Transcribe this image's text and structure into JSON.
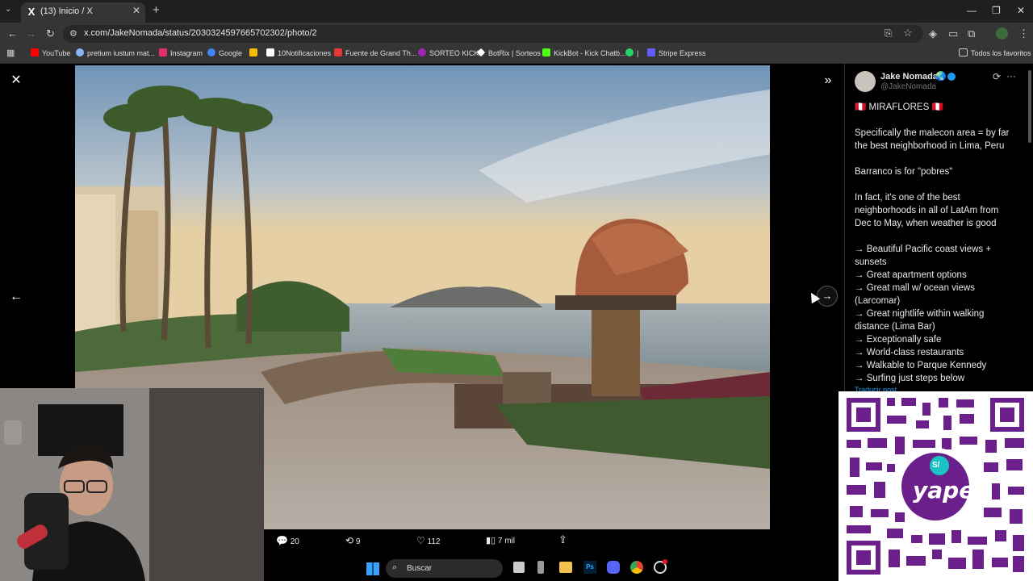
{
  "browser": {
    "tab": {
      "favicon": "X",
      "title": "(13) Inicio / X"
    },
    "url": "x.com/JakeNomada/status/2030324597665702302/photo/2",
    "bookmarks": [
      {
        "label": "YouTube",
        "color": "#ff0000"
      },
      {
        "label": "pretium iustum mat...",
        "color": "#8ab4f8"
      },
      {
        "label": "Instagram",
        "color": "#e1306c"
      },
      {
        "label": "Google",
        "color": "#4285f4"
      },
      {
        "label": "",
        "color": "#fbbc04"
      },
      {
        "label": "10Notificaciones",
        "color": "#ffffff"
      },
      {
        "label": "Fuente de Grand Th...",
        "color": "#e53935"
      },
      {
        "label": "SORTEO KICK",
        "color": "#9c27b0"
      },
      {
        "label": "BotRix | Sorteos",
        "color": "#ffffff"
      },
      {
        "label": "KickBot - Kick Chatb...",
        "color": "#53fc18"
      },
      {
        "label": "|",
        "color": "#25d366"
      },
      {
        "label": "Stripe Express",
        "color": "#635bff"
      }
    ],
    "all_bookmarks": "Todos los favoritos"
  },
  "tweet": {
    "author_name": "Jake Nomada",
    "handle": "@JakeNomada",
    "lines": [
      "🇵🇪 MIRAFLORES 🇵🇪",
      "",
      "Specifically the malecon area = by far",
      "the best neighborhood in Lima, Peru",
      "",
      "Barranco is for \"pobres\"",
      "",
      "In fact, it's one of the best",
      "neighborhoods in all of LatAm from",
      "Dec to May, when weather is good",
      "",
      "→ Beautiful Pacific coast views +",
      "sunsets",
      "→ Great apartment options",
      "→ Great mall w/ ocean views",
      "(Larcomar)",
      "→ Great nightlife within walking",
      "distance (Lima Bar)",
      "→ Exceptionally safe",
      "→ World-class restaurants",
      "→ Walkable to Parque Kennedy",
      "→ Surfing just steps below"
    ],
    "translate": "Traducir post"
  },
  "actions": {
    "replies": "20",
    "reposts": "9",
    "likes": "112",
    "views": "7 mil"
  },
  "taskbar": {
    "search": "Buscar"
  },
  "qr": {
    "brand": "yape",
    "currency": "S/"
  }
}
